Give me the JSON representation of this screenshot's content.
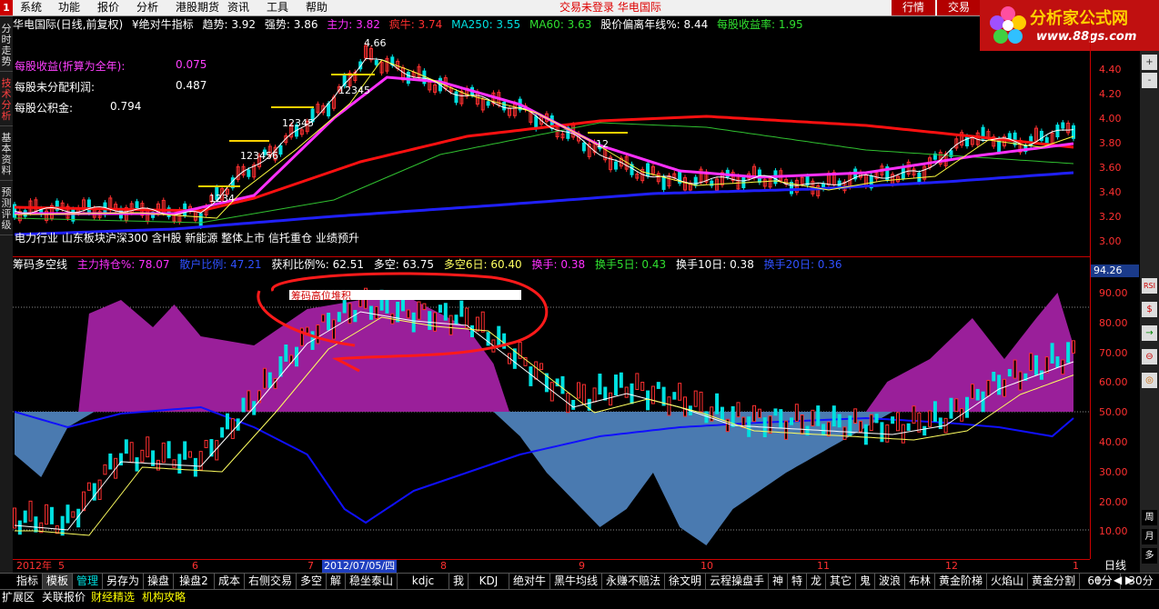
{
  "menu": {
    "logo": "1",
    "items": [
      "系统",
      "功能",
      "报价",
      "分析",
      "港股期货",
      "资讯",
      "工具",
      "帮助"
    ],
    "status": "交易未登录  华电国际",
    "buttons": [
      "行情",
      "交易"
    ]
  },
  "brand": {
    "name": "分析家公式网",
    "url": "www.88gs.com"
  },
  "left_tabs": [
    "分时走势",
    "技术分析",
    "基本资料",
    "预测评级"
  ],
  "info": {
    "stock": "华电国际(日线,前复权)",
    "indicator": "¥绝对牛指标",
    "trend": "趋势: 3.92",
    "strength": "强势: 3.86",
    "main": "主力: 3.82",
    "crazy": "疯牛: 3.74",
    "ma250": "MA250: 3.55",
    "ma60": "MA60: 3.63",
    "deviation": "股价偏离年线%: 8.44",
    "eps_rate": "每股收益率: 1.95"
  },
  "fundamentals": [
    {
      "label": "每股收益(折算为全年):",
      "value": "0.075"
    },
    {
      "label": "每股未分配利润:",
      "value": "0.487"
    },
    {
      "label": "每股公积金:",
      "value": "0.794"
    }
  ],
  "concepts": "电力行业 山东板块沪深300 含H股 新能源 整体上市 信托重仓 业绩预升",
  "price_labels": [
    "4.40",
    "4.20",
    "4.00",
    "3.80",
    "3.60",
    "3.40",
    "3.20",
    "3.00"
  ],
  "candle_annotations": [
    "4.66",
    "12345",
    "12345",
    "123456",
    "1234",
    "12"
  ],
  "indicator": {
    "name": "筹码多空线",
    "main_hold": "主力持仓%: 78.07",
    "ret_ratio": "散户比例: 47.21",
    "profit": "获利比例%: 62.51",
    "long_short": "多空: 63.75",
    "ls6": "多空6日: 60.40",
    "turnover": "换手: 0.38",
    "t5": "换手5日: 0.43",
    "t10": "换手10日: 0.38",
    "t20": "换手20日: 0.36",
    "current": "94.26"
  },
  "annotation": "筹码高位堆积",
  "ind_labels": [
    "90.00",
    "80.00",
    "70.00",
    "60.00",
    "50.00",
    "40.00",
    "30.00",
    "20.00",
    "10.00"
  ],
  "dates": [
    "2012年",
    "5",
    "6",
    "7",
    "2012/07/05/四",
    "8",
    "9",
    "10",
    "11",
    "12",
    "1"
  ],
  "period": "日线",
  "tabs": [
    "指标",
    "模板",
    "管理",
    "另存为",
    "操盘",
    "操盘2",
    "成本",
    "右侧交易",
    "多空",
    "解",
    "稳坐泰山",
    "kdjc",
    "我",
    "KDJ",
    "绝对牛",
    "黑牛均线",
    "永赚不赔法",
    "徐文明",
    "云程操盘手",
    "神",
    "特",
    "龙",
    "其它",
    "鬼",
    "波浪",
    "布林",
    "黄金阶梯",
    "火焰山",
    "黄金分割",
    "60分",
    "30分"
  ],
  "bottom": [
    "扩展区",
    "关联报价",
    "财经精选",
    "机构攻略"
  ],
  "tools": [
    "+",
    "-",
    "RSI",
    "$",
    "→",
    "⊖",
    "◎",
    "周",
    "月",
    "多"
  ],
  "colors": {
    "up": "#ff3030",
    "down": "#00ffff",
    "ma_red": "#ff1010",
    "ma_magenta": "#ff30ff",
    "ma_blue": "#2020ff",
    "ma_green": "#30c030",
    "purple_area": "#9a1f9a",
    "blue_area": "#4a7ab0"
  }
}
